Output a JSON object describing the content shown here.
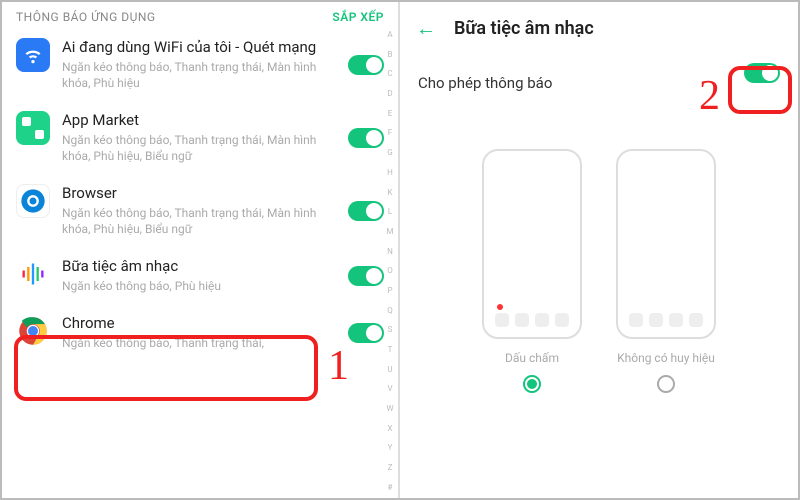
{
  "left": {
    "header_title": "THÔNG BÁO ỨNG DỤNG",
    "sort_label": "SẮP XẾP",
    "az_index": [
      "A",
      "B",
      "C",
      "D",
      "E",
      "F",
      "G",
      "H",
      "K",
      "L",
      "M",
      "N",
      "O",
      "P",
      "Q",
      "S",
      "T",
      "U",
      "V",
      "W",
      "X",
      "Y",
      "Z",
      "#"
    ],
    "apps": [
      {
        "name": "Ai đang dùng WiFi của tôi - Quét mạng",
        "sub": "Ngăn kéo thông báo, Thanh trạng thái, Màn hình khóa, Phù hiệu",
        "icon": "wifi",
        "on": true
      },
      {
        "name": "App Market",
        "sub": "Ngăn kéo thông báo, Thanh trạng thái, Màn hình khóa, Phù hiệu, Biểu ngữ",
        "icon": "market",
        "on": true
      },
      {
        "name": "Browser",
        "sub": "Ngăn kéo thông báo, Thanh trạng thái, Màn hình khóa, Phù hiệu, Biểu ngữ",
        "icon": "browser",
        "on": true
      },
      {
        "name": "Bữa tiệc âm nhạc",
        "sub": "Ngăn kéo thông báo, Phù hiệu",
        "icon": "music",
        "on": true
      },
      {
        "name": "Chrome",
        "sub": "Ngăn kéo thông báo, Thanh trạng thái,",
        "icon": "chrome",
        "on": true
      }
    ]
  },
  "right": {
    "title": "Bữa tiệc âm nhạc",
    "allow_label": "Cho phép thông báo",
    "allow_on": true,
    "options": [
      {
        "label": "Dấu chấm",
        "selected": true,
        "style": "dot"
      },
      {
        "label": "Không có huy hiệu",
        "selected": false,
        "style": "none"
      }
    ]
  },
  "annotations": {
    "step1": "1",
    "step2": "2"
  },
  "colors": {
    "accent": "#15c47c",
    "highlight": "#f02020"
  }
}
